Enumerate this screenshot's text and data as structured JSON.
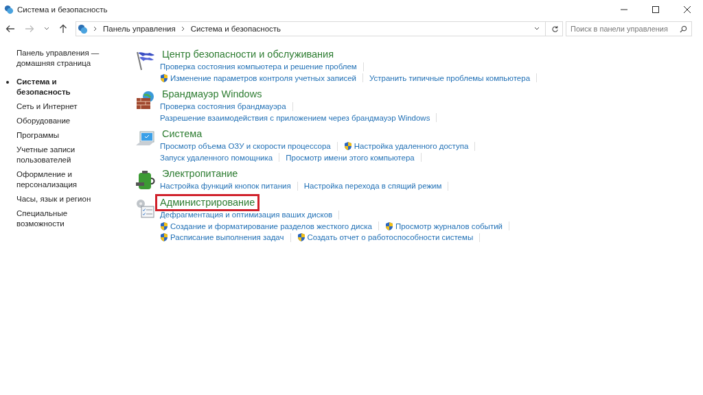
{
  "window": {
    "title": "Система и безопасность"
  },
  "address": {
    "crumbs": [
      "Панель управления",
      "Система и безопасность"
    ]
  },
  "search": {
    "placeholder": "Поиск в панели управления"
  },
  "sidebar": {
    "home": "Панель управления — домашняя страница",
    "items": [
      {
        "label": "Система и безопасность",
        "selected": true
      },
      {
        "label": "Сеть и Интернет",
        "selected": false
      },
      {
        "label": "Оборудование",
        "selected": false
      },
      {
        "label": "Программы",
        "selected": false
      },
      {
        "label": "Учетные записи пользователей",
        "selected": false
      },
      {
        "label": "Оформление и персонализация",
        "selected": false
      },
      {
        "label": "Часы, язык и регион",
        "selected": false
      },
      {
        "label": "Специальные возможности",
        "selected": false
      }
    ]
  },
  "categories": [
    {
      "kind": "flag",
      "title": "Центр безопасности и обслуживания",
      "highlighted": false,
      "lines": [
        [
          {
            "label": "Проверка состояния компьютера и решение проблем",
            "shield": false
          }
        ],
        [
          {
            "label": "Изменение параметров контроля учетных записей",
            "shield": true
          },
          {
            "label": "Устранить типичные проблемы компьютера",
            "shield": false
          }
        ]
      ]
    },
    {
      "kind": "wall",
      "title": "Брандмауэр Windows",
      "highlighted": false,
      "lines": [
        [
          {
            "label": "Проверка состояния брандмауэра",
            "shield": false
          }
        ],
        [
          {
            "label": "Разрешение взаимодействия с приложением через брандмауэр Windows",
            "shield": false
          }
        ]
      ]
    },
    {
      "kind": "computer",
      "title": "Система",
      "highlighted": false,
      "lines": [
        [
          {
            "label": "Просмотр объема ОЗУ и скорости процессора",
            "shield": false
          },
          {
            "label": "Настройка удаленного доступа",
            "shield": true
          }
        ],
        [
          {
            "label": "Запуск удаленного помощника",
            "shield": false
          },
          {
            "label": "Просмотр имени этого компьютера",
            "shield": false
          }
        ]
      ]
    },
    {
      "kind": "battery",
      "title": "Электропитание",
      "highlighted": false,
      "lines": [
        [
          {
            "label": "Настройка функций кнопок питания",
            "shield": false
          },
          {
            "label": "Настройка перехода в спящий режим",
            "shield": false
          }
        ]
      ]
    },
    {
      "kind": "tools",
      "title": "Администрирование",
      "highlighted": true,
      "lines": [
        [
          {
            "label": "Дефрагментация и оптимизация ваших дисков",
            "shield": false
          }
        ],
        [
          {
            "label": "Создание и форматирование разделов жесткого диска",
            "shield": true
          },
          {
            "label": "Просмотр журналов событий",
            "shield": true
          }
        ],
        [
          {
            "label": "Расписание выполнения задач",
            "shield": true
          },
          {
            "label": "Создать отчет о работоспособности системы",
            "shield": true
          }
        ]
      ]
    }
  ]
}
